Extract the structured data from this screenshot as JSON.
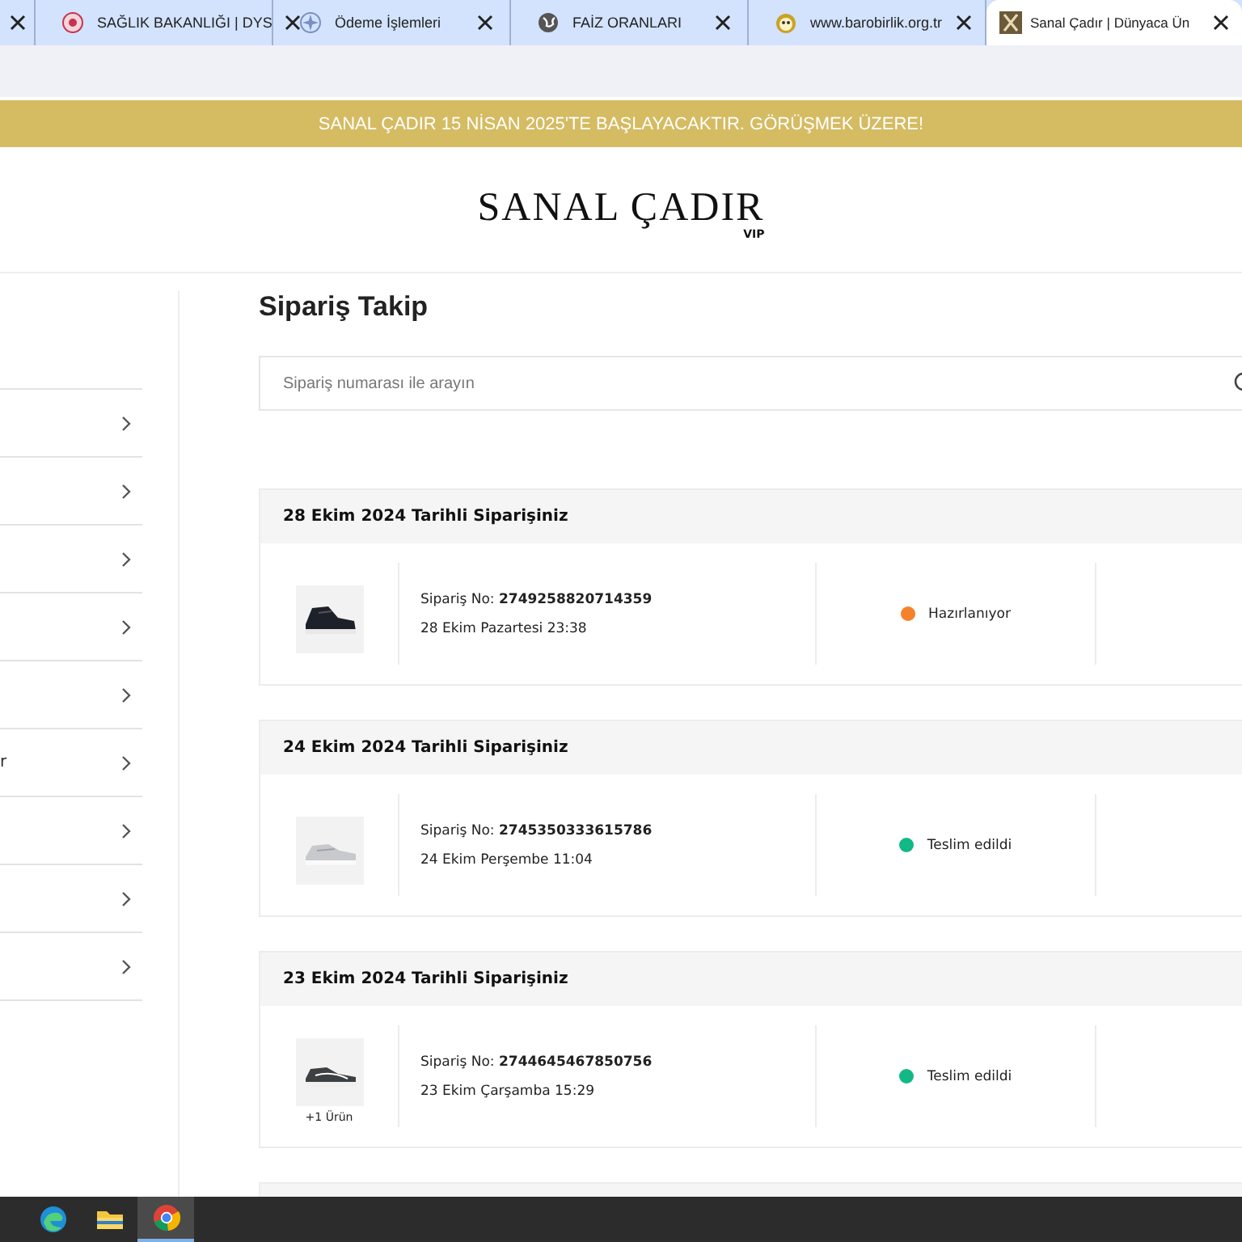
{
  "browser_tabs": [
    {
      "selected": false
    },
    {
      "title": "SAĞLIK BAKANLIĞI | DYS",
      "selected": false
    },
    {
      "title": "Ödeme İşlemleri",
      "selected": false
    },
    {
      "title": "FAİZ ORANLARI",
      "selected": false
    },
    {
      "title": "www.barobirlik.org.tr",
      "selected": false
    },
    {
      "title": "Sanal Çadır | Dünyaca Ün",
      "selected": true
    }
  ],
  "banner": {
    "text": "SANAL ÇADIR 15 NİSAN 2025'TE BAŞLAYACAKTIR. GÖRÜŞMEK ÜZERE!"
  },
  "logo": {
    "name": "SANAL ÇADIR",
    "tag": "VIP"
  },
  "sidebar": {
    "items": [
      {
        "expanded": false
      },
      {
        "expanded": false
      },
      {
        "expanded": false
      },
      {
        "expanded": false
      },
      {
        "expanded": false
      },
      {
        "label": "r",
        "expanded": false
      },
      {
        "expanded": false
      },
      {
        "expanded": false
      },
      {
        "expanded": false
      }
    ]
  },
  "page_title": "Sipariş Takip",
  "search": {
    "placeholder": "Sipariş numarası ile arayın"
  },
  "orders": [
    {
      "heading": "28 Ekim 2024 Tarihli Siparişiniz",
      "order_label": "Sipariş No:",
      "order_no": "2749258820714359",
      "date": "28 Ekim Pazartesi 23:38",
      "status": "Hazırlanıyor",
      "color": "#f5822a",
      "kind": "full"
    },
    {
      "heading": "24 Ekim 2024 Tarihli Siparişiniz",
      "order_label": "Sipariş No:",
      "order_no": "2745350333615786",
      "date": "24 Ekim Perşembe 11:04",
      "status": "Teslim edildi",
      "color": "#12b886",
      "kind": "full"
    },
    {
      "heading": "23 Ekim 2024 Tarihli Siparişiniz",
      "order_label": "Sipariş No:",
      "order_no": "2744645467850756",
      "date": "23 Ekim Çarşamba 15:29",
      "status": "Teslim edildi",
      "color": "#12b886",
      "kind": "full",
      "extra": "+1 Ürün"
    },
    {
      "kind": "stub"
    }
  ],
  "taskbar": {
    "apps": [
      {
        "kind": "edge",
        "selected": false
      },
      {
        "kind": "folder",
        "selected": false
      },
      {
        "kind": "chrome",
        "selected": true
      }
    ]
  }
}
